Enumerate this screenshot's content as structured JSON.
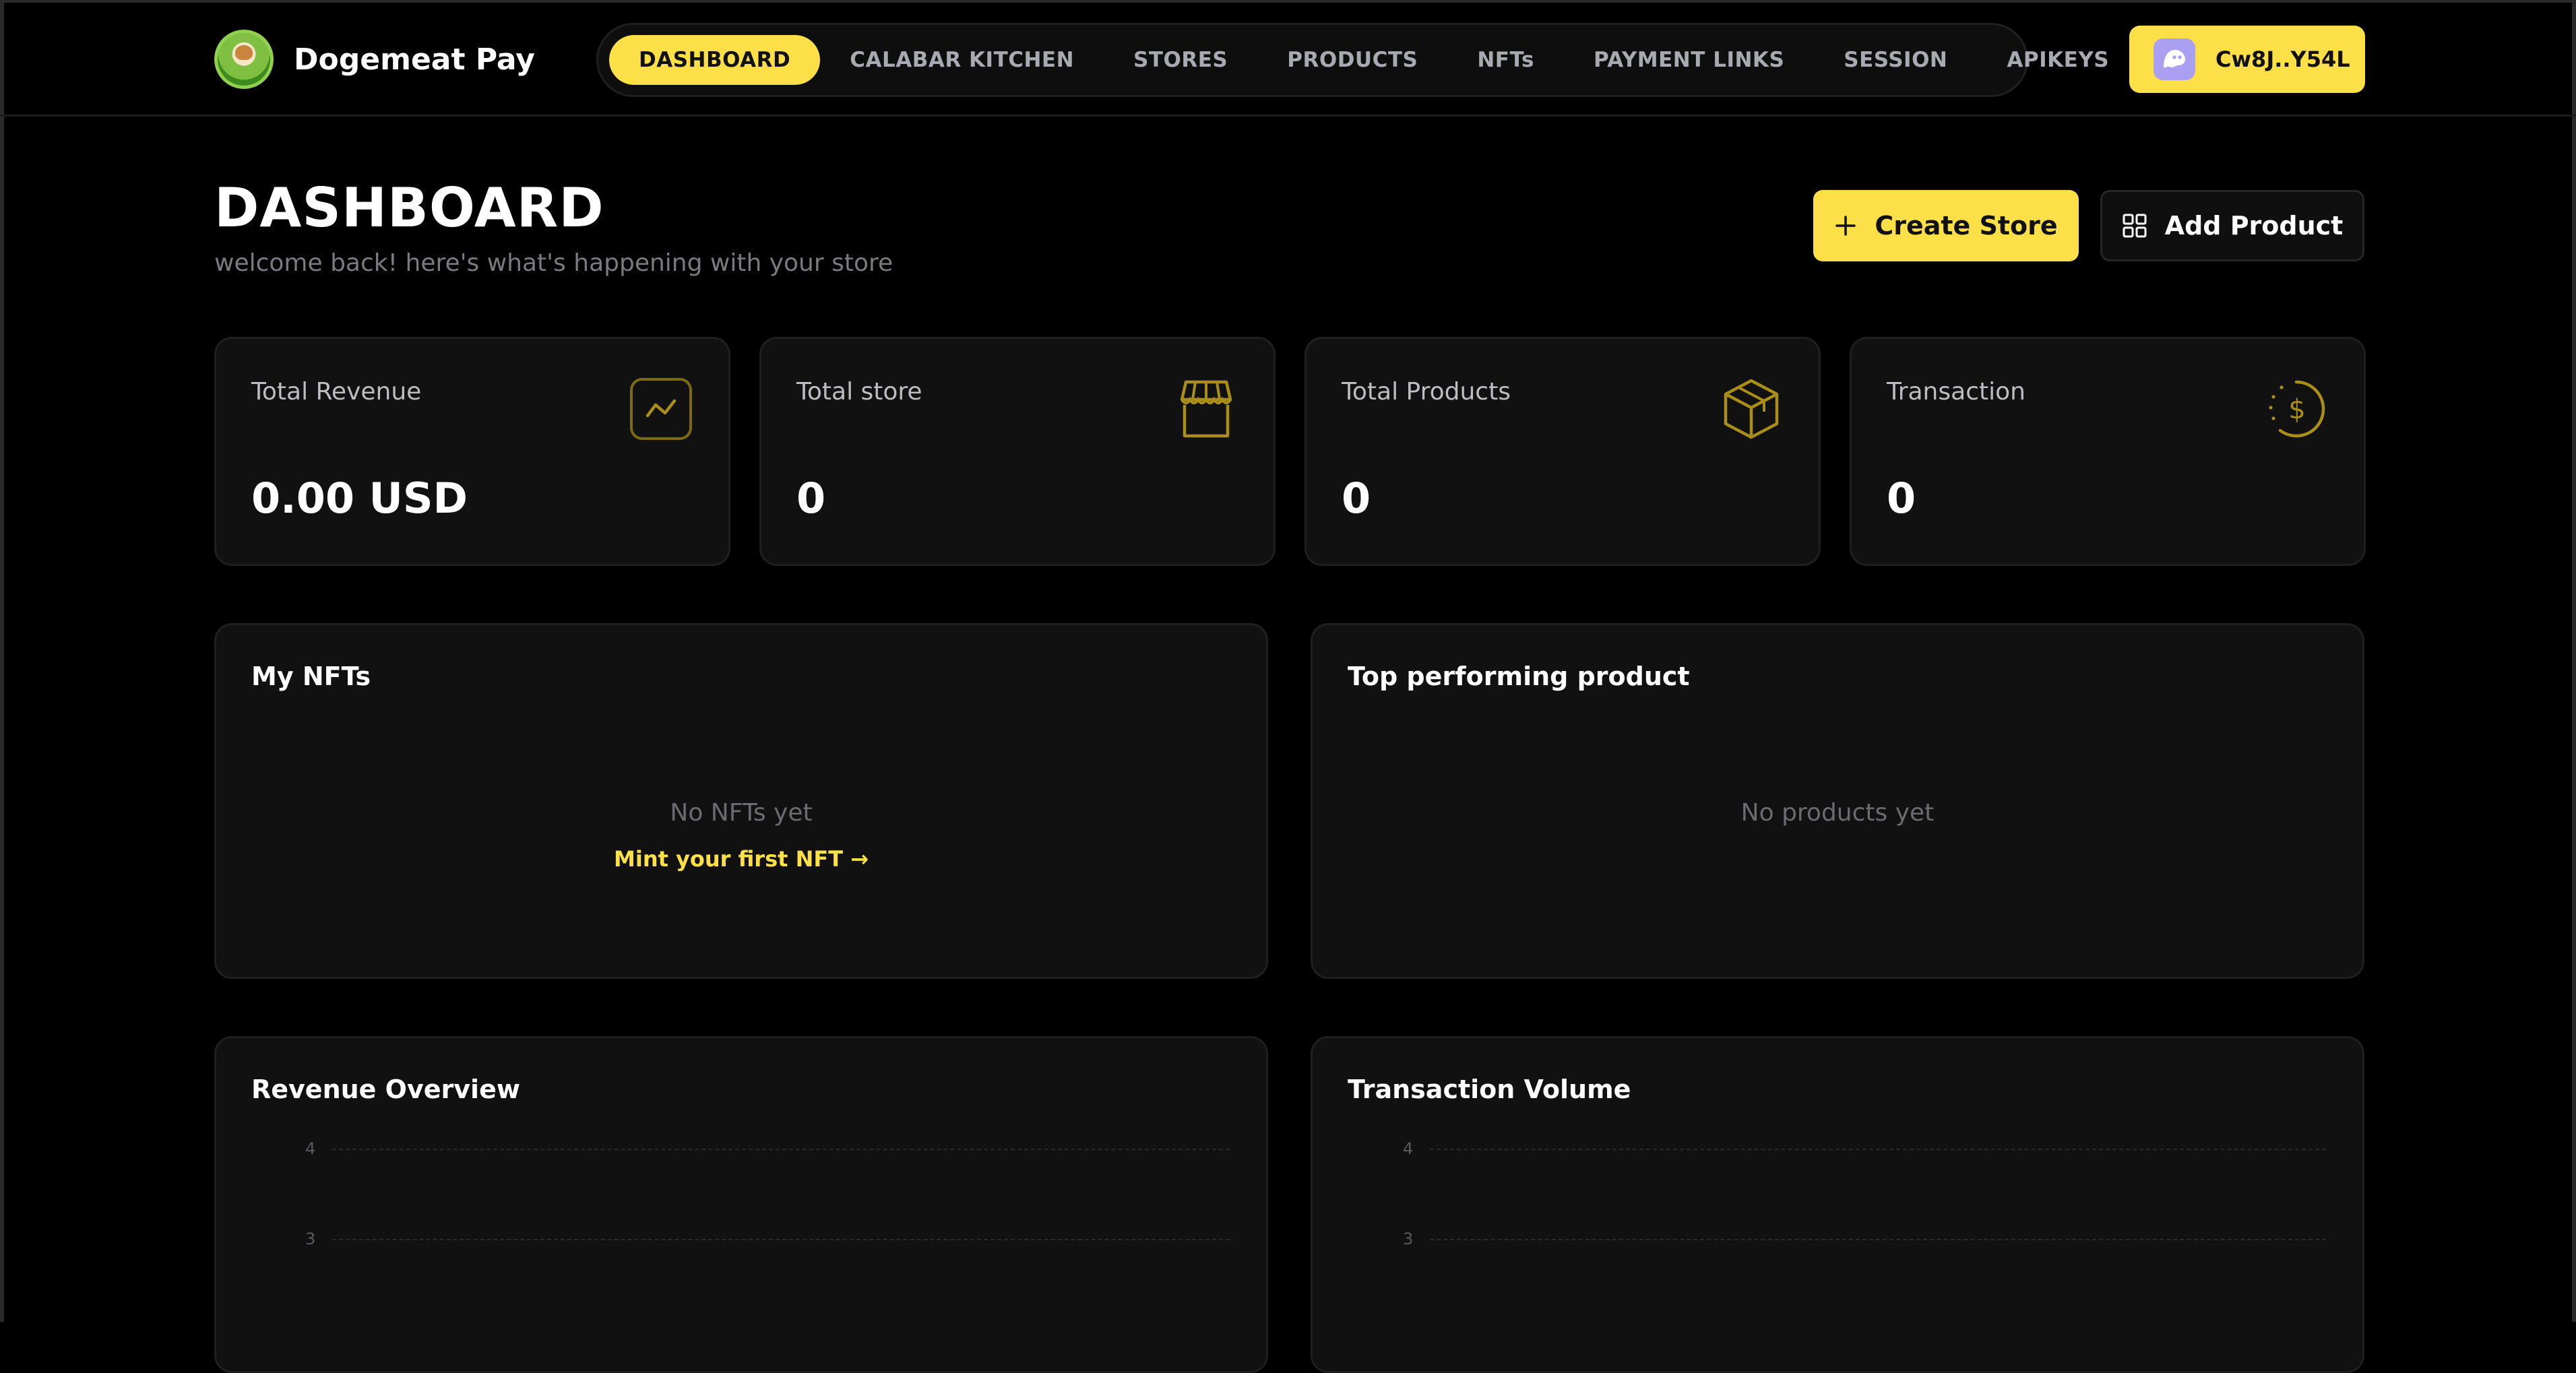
{
  "brand": {
    "name": "Dogemeat Pay"
  },
  "nav": {
    "items": [
      {
        "label": "DASHBOARD",
        "active": true
      },
      {
        "label": "CALABAR KITCHEN",
        "active": false
      },
      {
        "label": "STORES",
        "active": false
      },
      {
        "label": "PRODUCTS",
        "active": false
      },
      {
        "label": "NFTs",
        "active": false
      },
      {
        "label": "PAYMENT LINKS",
        "active": false
      },
      {
        "label": "SESSION",
        "active": false
      },
      {
        "label": "APIKEYS",
        "active": false
      }
    ]
  },
  "wallet": {
    "address": "Cw8J..Y54L",
    "icon": "phantom-ghost-icon"
  },
  "header": {
    "title": "DASHBOARD",
    "subtitle": "welcome back! here's what's happening with your store"
  },
  "actions": {
    "create_store": {
      "label": "Create Store",
      "icon": "plus-icon"
    },
    "add_product": {
      "label": "Add Product",
      "icon": "grid-icon"
    }
  },
  "stats": [
    {
      "label": "Total Revenue",
      "value": "0.00 USD",
      "icon": "trend-chart-icon"
    },
    {
      "label": "Total store",
      "value": "0",
      "icon": "storefront-icon"
    },
    {
      "label": "Total Products",
      "value": "0",
      "icon": "package-box-icon"
    },
    {
      "label": "Transaction",
      "value": "0",
      "icon": "dollar-circle-icon"
    }
  ],
  "nfts": {
    "title": "My NFTs",
    "empty_text": "No NFTs yet",
    "cta": "Mint your first NFT →"
  },
  "top_product": {
    "title": "Top performing product",
    "empty_text": "No products yet"
  },
  "revenue_chart": {
    "title": "Revenue Overview",
    "y_ticks": [
      "4",
      "3"
    ]
  },
  "volume_chart": {
    "title": "Transaction Volume",
    "y_ticks": [
      "4",
      "3"
    ]
  },
  "colors": {
    "accent": "#fde047",
    "background": "#000000",
    "card": "#111111",
    "muted": "#7a7a80"
  }
}
